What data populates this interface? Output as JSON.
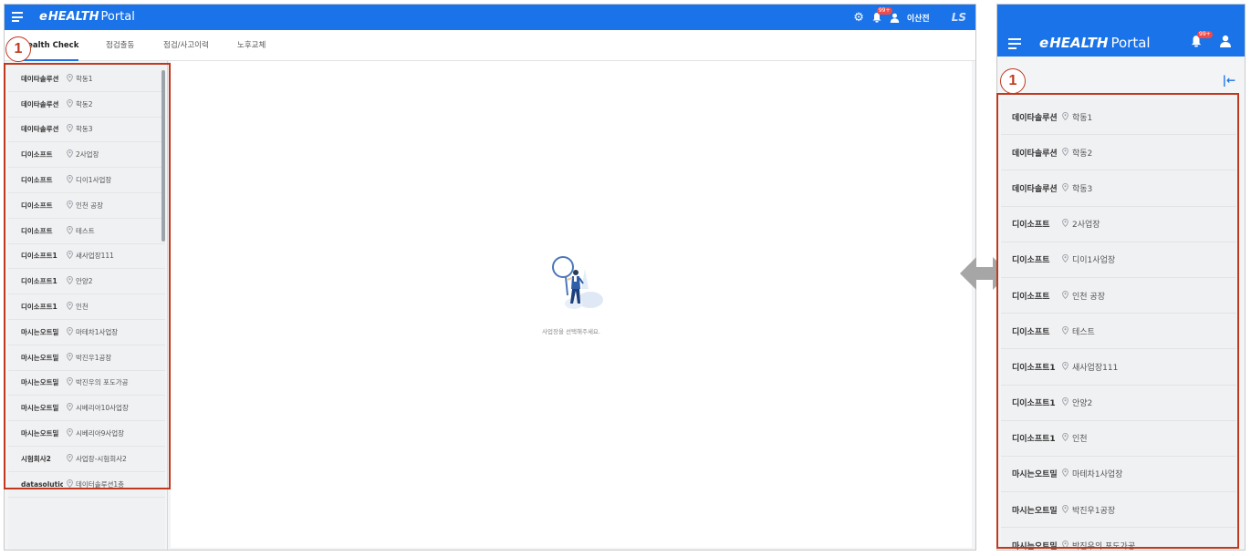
{
  "app": {
    "logo_e": "e",
    "logo_health": "HEALTH",
    "logo_portal": "Portal"
  },
  "header": {
    "badge": "99+",
    "user_name": "이산전",
    "brand": "LS"
  },
  "tabs": [
    {
      "label": "Health Check",
      "active": true
    },
    {
      "label": "점검출동",
      "active": false
    },
    {
      "label": "점검/사고이력",
      "active": false
    },
    {
      "label": "노후교체",
      "active": false
    }
  ],
  "sites": [
    {
      "company": "데이타솔루션",
      "place": "학동1"
    },
    {
      "company": "데이타솔루션",
      "place": "학동2"
    },
    {
      "company": "데이타솔루션",
      "place": "학동3"
    },
    {
      "company": "디이소프트",
      "place": "2사업장"
    },
    {
      "company": "디이소프트",
      "place": "디이1사업장"
    },
    {
      "company": "디이소프트",
      "place": "인천 공장"
    },
    {
      "company": "디이소프트",
      "place": "테스트"
    },
    {
      "company": "디이소프트1",
      "place": "새사업장111"
    },
    {
      "company": "디이소프트1",
      "place": "안양2"
    },
    {
      "company": "디이소프트1",
      "place": "인천"
    },
    {
      "company": "마시는오트밀",
      "place": "마테차1사업장"
    },
    {
      "company": "마시는오트밀",
      "place": "박진우1공장"
    },
    {
      "company": "마시는오트밀",
      "place": "박진우의 포도가공"
    },
    {
      "company": "마시는오트밀",
      "place": "시베리아10사업장"
    },
    {
      "company": "마시는오트밀",
      "place": "시베리아9사업장"
    },
    {
      "company": "시험회사2",
      "place": "사업장-시험회사2"
    },
    {
      "company": "datasolution",
      "place": "데이터솔루션1층"
    }
  ],
  "main": {
    "empty_message": "사업장을 선택해주세요."
  },
  "annotation": {
    "number": "1"
  },
  "colors": {
    "primary": "#1a73e8",
    "annotation": "#c0391f",
    "badge": "#f04a4a"
  }
}
